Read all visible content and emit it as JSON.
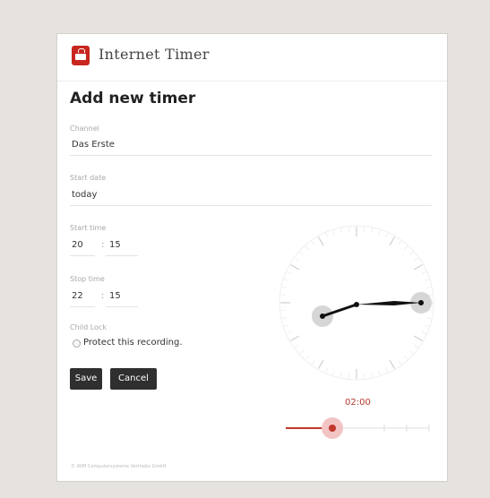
{
  "app": {
    "title": "Internet Timer",
    "icon": "tv-icon"
  },
  "page": {
    "title": "Add new timer"
  },
  "form": {
    "channel": {
      "label": "Channel",
      "value": "Das Erste"
    },
    "start_date": {
      "label": "Start date",
      "value": "today"
    },
    "start_time": {
      "label": "Start time",
      "hour": "20",
      "separator": ":",
      "minute": "15"
    },
    "stop_time": {
      "label": "Stop time",
      "hour": "22",
      "separator": ":",
      "minute": "15"
    },
    "child_lock": {
      "label": "Child Lock",
      "option_label": "Protect this recording.",
      "checked": false
    }
  },
  "buttons": {
    "save": "Save",
    "cancel": "Cancel"
  },
  "timer": {
    "duration": "02:00"
  },
  "footer": {
    "text": "© AVM Computersysteme Vertriebs GmbH"
  },
  "colors": {
    "accent": "#c8261f",
    "slider_fill": "#c0392b",
    "button_bg": "#2f2f2f"
  }
}
